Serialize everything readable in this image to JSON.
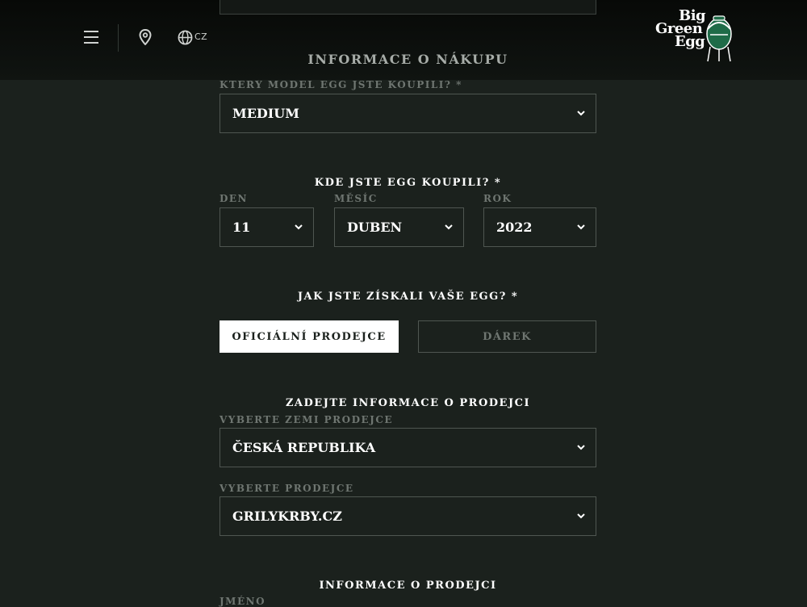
{
  "header": {
    "language": "CZ",
    "logo": {
      "line1": "Big",
      "line2": "Green",
      "line3": "Egg"
    }
  },
  "page_title": "INFORMACE O NÁKUPU",
  "model": {
    "label": "KTERÝ MODEL EGG JSTE KOUPILI? *",
    "value": "MEDIUM"
  },
  "purchase_date": {
    "title": "KDE JSTE EGG KOUPILI? *",
    "day": {
      "label": "DEN",
      "value": "11"
    },
    "month": {
      "label": "MĚSÍC",
      "value": "DUBEN"
    },
    "year": {
      "label": "ROK",
      "value": "2022"
    }
  },
  "acquisition": {
    "title": "JAK JSTE ZÍSKALI VAŠE EGG? *",
    "options": [
      "OFICIÁLNÍ PRODEJCE",
      "DÁREK"
    ],
    "selected": "OFICIÁLNÍ PRODEJCE"
  },
  "dealer_info": {
    "title": "ZADEJTE INFORMACE O PRODEJCI",
    "country": {
      "label": "VYBERTE ZEMI PRODEJCE",
      "value": "ČESKÁ REPUBLIKA"
    },
    "dealer": {
      "label": "VYBERTE PRODEJCE",
      "value": "GRILYKRBY.CZ"
    }
  },
  "dealer_details": {
    "title": "INFORMACE O PRODEJCI",
    "name_label": "JMÉNO"
  },
  "colors": {
    "background": "#1b211d",
    "accent_white": "#ffffff",
    "muted_label": "#6f7671",
    "border": "#4f5651"
  }
}
